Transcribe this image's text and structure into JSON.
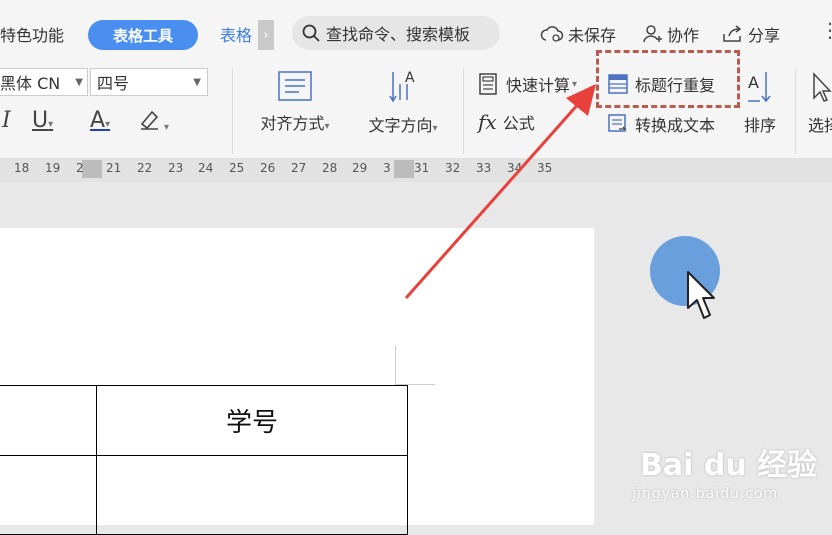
{
  "tabs": {
    "features": "特色功能",
    "table_tools": "表格工具",
    "table_style": "表格",
    "more": "›"
  },
  "search": {
    "label": "查找命令、搜索模板"
  },
  "header": {
    "unsaved": "未保存",
    "collab": "协作",
    "share": "分享"
  },
  "ribbon": {
    "font_name": "黑体 CN",
    "font_size": "四号",
    "align_label": "对齐方式",
    "text_direction_label": "文字方向",
    "quick_calc_label": "快速计算",
    "formula_label": "公式",
    "repeat_header_label": "标题行重复",
    "convert_text_label": "转换成文本",
    "sort_label": "排序",
    "select_label": "选择"
  },
  "ruler": {
    "ticks": [
      "18",
      "19",
      "2",
      "21",
      "22",
      "23",
      "24",
      "25",
      "26",
      "27",
      "28",
      "29",
      "3",
      "31",
      "32",
      "33",
      "34",
      "35"
    ]
  },
  "document": {
    "header_cell": "学号"
  },
  "watermark": {
    "brand": "Bai du 经验",
    "url": "jingyan.baidu.com"
  },
  "colors": {
    "accent": "#4a8ef0",
    "highlight_box": "#b85a4e",
    "arrow": "#e8413b",
    "cursor": "#5b97dc"
  }
}
